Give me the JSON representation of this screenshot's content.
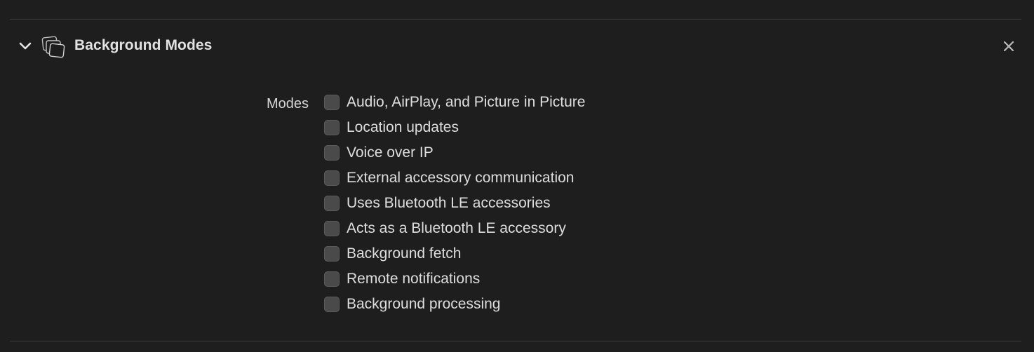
{
  "capability": {
    "title": "Background Modes",
    "icon": "background-modes-icon",
    "expanded": true
  },
  "modes": {
    "label": "Modes",
    "options": [
      {
        "label": "Audio, AirPlay, and Picture in Picture",
        "checked": false
      },
      {
        "label": "Location updates",
        "checked": false
      },
      {
        "label": "Voice over IP",
        "checked": false
      },
      {
        "label": "External accessory communication",
        "checked": false
      },
      {
        "label": "Uses Bluetooth LE accessories",
        "checked": false
      },
      {
        "label": "Acts as a Bluetooth LE accessory",
        "checked": false
      },
      {
        "label": "Background fetch",
        "checked": false
      },
      {
        "label": "Remote notifications",
        "checked": false
      },
      {
        "label": "Background processing",
        "checked": false
      }
    ]
  },
  "colors": {
    "background": "#1e1e1e",
    "divider": "#3a3a3a",
    "checkbox": "#4a4a4a",
    "text": "#dedede"
  }
}
